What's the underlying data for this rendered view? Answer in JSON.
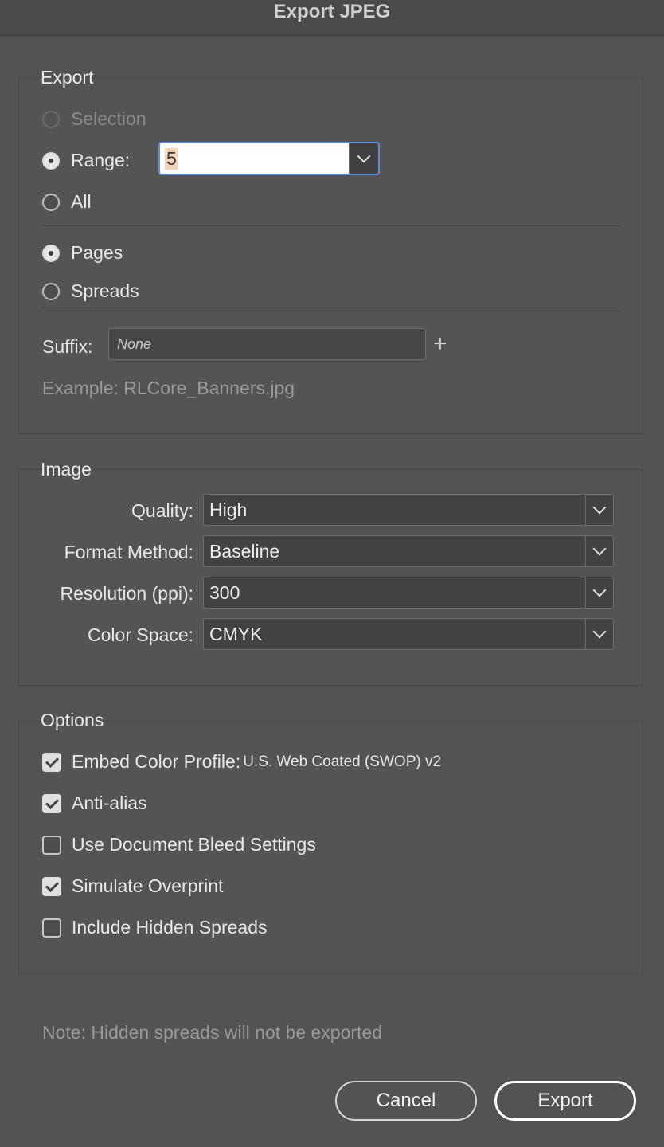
{
  "window": {
    "title": "Export JPEG"
  },
  "export_section": {
    "legend": "Export",
    "selection_label": "Selection",
    "range_label": "Range:",
    "range_value": "5",
    "all_label": "All",
    "pages_label": "Pages",
    "spreads_label": "Spreads",
    "suffix_label": "Suffix:",
    "suffix_placeholder": "None",
    "example_text": "Example:  RLCore_Banners.jpg"
  },
  "image_section": {
    "legend": "Image",
    "fields": [
      {
        "label": "Quality:",
        "value": "High"
      },
      {
        "label": "Format Method:",
        "value": "Baseline"
      },
      {
        "label": "Resolution (ppi):",
        "value": "300"
      },
      {
        "label": "Color Space:",
        "value": "CMYK"
      }
    ]
  },
  "options_section": {
    "legend": "Options",
    "items": [
      {
        "label": "Embed Color Profile:",
        "checked": true,
        "value": "U.S. Web Coated (SWOP) v2"
      },
      {
        "label": "Anti-alias",
        "checked": true
      },
      {
        "label": "Use Document Bleed Settings",
        "checked": false
      },
      {
        "label": "Simulate Overprint",
        "checked": true
      },
      {
        "label": "Include Hidden Spreads",
        "checked": false
      }
    ]
  },
  "note": "Note: Hidden spreads will not be exported",
  "buttons": {
    "cancel": "Cancel",
    "export": "Export"
  }
}
